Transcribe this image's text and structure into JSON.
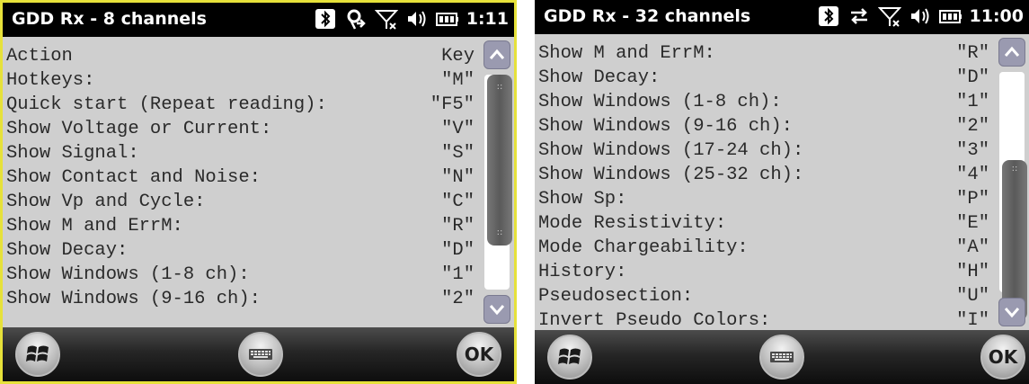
{
  "left": {
    "title": "GDD Rx - 8 channels",
    "time": "1:11",
    "header": {
      "action": "Action",
      "key": "Key"
    },
    "rows": [
      {
        "action": "",
        "key": ""
      },
      {
        "action": "Hotkeys:",
        "key": "\"M\""
      },
      {
        "action": "Quick start (Repeat reading):",
        "key": "\"F5\""
      },
      {
        "action": "Show Voltage or Current:",
        "key": "\"V\""
      },
      {
        "action": "Show Signal:",
        "key": "\"S\""
      },
      {
        "action": "Show Contact and Noise:",
        "key": "\"N\""
      },
      {
        "action": "Show Vp and Cycle:",
        "key": "\"C\""
      },
      {
        "action": "Show M and ErrM:",
        "key": "\"R\""
      },
      {
        "action": "Show Decay:",
        "key": "\"D\""
      },
      {
        "action": "Show Windows (1-8 ch):",
        "key": "\"1\""
      },
      {
        "action": "Show Windows (9-16 ch):",
        "key": "\"2\""
      }
    ],
    "ok_label": "OK"
  },
  "right": {
    "title": "GDD Rx - 32 channels",
    "time": "11:00",
    "rows": [
      {
        "action": "Show M and ErrM:",
        "key": "\"R\""
      },
      {
        "action": "Show Decay:",
        "key": "\"D\""
      },
      {
        "action": "Show Windows (1-8 ch):",
        "key": "\"1\""
      },
      {
        "action": "Show Windows (9-16 ch):",
        "key": "\"2\""
      },
      {
        "action": "Show Windows (17-24 ch):",
        "key": "\"3\""
      },
      {
        "action": "Show Windows (25-32 ch):",
        "key": "\"4\""
      },
      {
        "action": "Show Sp:",
        "key": "\"P\""
      },
      {
        "action": "Mode Resistivity:",
        "key": "\"E\""
      },
      {
        "action": "Mode Chargeability:",
        "key": "\"A\""
      },
      {
        "action": "History:",
        "key": "\"H\""
      },
      {
        "action": "Pseudosection:",
        "key": "\"U\""
      },
      {
        "action": "Invert Pseudo Colors:",
        "key": "\"I\""
      }
    ],
    "ok_label": "OK"
  },
  "icons": {
    "bluetooth": "bluetooth-icon",
    "sync": "sync-icon",
    "data": "data-transfer-icon",
    "signal": "no-signal-icon",
    "volume": "volume-icon",
    "battery": "battery-icon",
    "start": "windows-start-icon",
    "keyboard": "keyboard-icon"
  }
}
